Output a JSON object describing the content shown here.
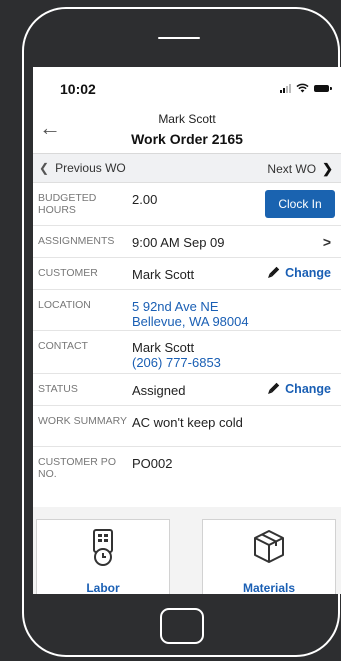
{
  "status_bar": {
    "time": "10:02"
  },
  "header": {
    "customer_name": "Mark Scott",
    "title": "Work Order 2165",
    "back_icon": "back-arrow-icon"
  },
  "nav": {
    "prev_label": "Previous WO",
    "next_label": "Next WO"
  },
  "fields": {
    "budgeted_hours": {
      "label": "BUDGETED HOURS",
      "value": "2.00",
      "action": "Clock In"
    },
    "assignments": {
      "label": "ASSIGNMENTS",
      "value": "9:00 AM Sep 09"
    },
    "customer": {
      "label": "CUSTOMER",
      "value": "Mark Scott",
      "action": "Change"
    },
    "location": {
      "label": "LOCATION",
      "line1": "5 92nd Ave NE",
      "line2": "Bellevue, WA 98004"
    },
    "contact": {
      "label": "CONTACT",
      "name": "Mark Scott",
      "phone": "(206) 777-6853"
    },
    "status": {
      "label": "STATUS",
      "value": "Assigned",
      "action": "Change"
    },
    "work_summary": {
      "label": "WORK SUMMARY",
      "value": "AC won't keep cold"
    },
    "customer_po": {
      "label": "CUSTOMER PO NO.",
      "value": "PO002"
    }
  },
  "tiles": [
    {
      "label": "Labor",
      "icon": "timecard-clock-icon"
    },
    {
      "label": "Materials",
      "icon": "package-box-icon"
    }
  ],
  "colors": {
    "accent": "#1a63b0",
    "link": "#1a5fb4",
    "frame_bg": "#2d2e30"
  }
}
